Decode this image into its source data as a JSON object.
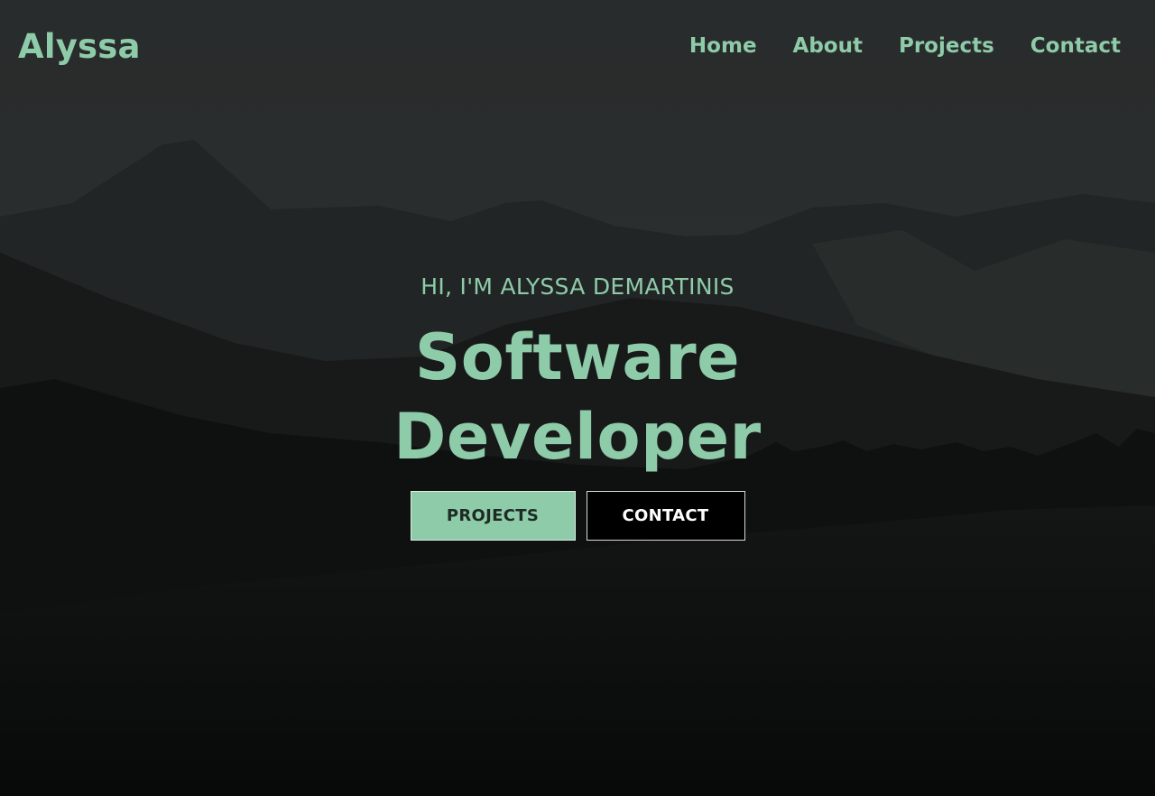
{
  "colors": {
    "accent": "#8ecba9",
    "background_dark": "#0d0f0f",
    "button_contact_bg": "#000000",
    "button_contact_text": "#ffffff"
  },
  "navbar": {
    "brand": "Alyssa",
    "links": [
      {
        "label": "Home"
      },
      {
        "label": "About"
      },
      {
        "label": "Projects"
      },
      {
        "label": "Contact"
      }
    ]
  },
  "hero": {
    "greeting": "HI, I'M ALYSSA DEMARTINIS",
    "title_line1": "Software",
    "title_line2": "Developer",
    "buttons": {
      "projects_label": "PROJECTS",
      "contact_label": "CONTACT"
    }
  }
}
